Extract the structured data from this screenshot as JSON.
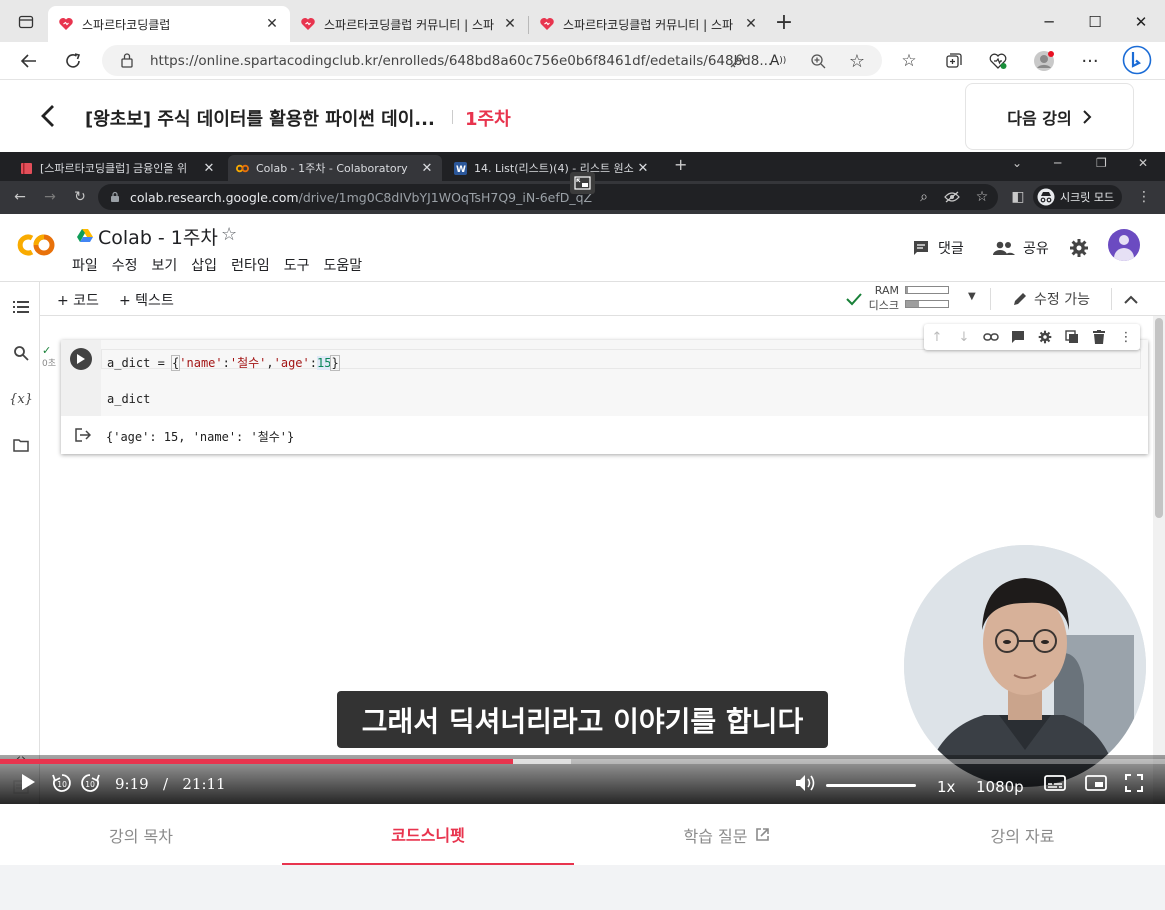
{
  "edge": {
    "tabs": [
      {
        "label": "스파르타코딩클럽"
      },
      {
        "label": "스파르타코딩클럽 커뮤니티 | 스파"
      },
      {
        "label": "스파르타코딩클럽 커뮤니티 | 스파"
      }
    ],
    "url": "https://online.spartacodingclub.kr/enrolleds/648bd8a60c756e0b6f8461df/edetails/648bd8..."
  },
  "course": {
    "title": "[왕초보] 주식 데이터를 활용한 파이썬 데이...",
    "week": "1주차",
    "next_label": "다음 강의"
  },
  "chrome": {
    "tabs": [
      {
        "label": "[스파르타코딩클럽] 금융인을 위"
      },
      {
        "label": "Colab - 1주차 - Colaboratory"
      },
      {
        "label": "14. List(리스트)(4) - 리스트 원소"
      }
    ],
    "url_domain": "colab.research.google.com",
    "url_path": "/drive/1mg0C8dIVbYJ1WOqTsH7Q9_iN-6efD_qZ",
    "incognito_label": "시크릿 모드"
  },
  "colab": {
    "title": "Colab - 1주차",
    "menu": [
      "파일",
      "수정",
      "보기",
      "삽입",
      "런타임",
      "도구",
      "도움말"
    ],
    "comment_label": "댓글",
    "share_label": "공유",
    "add_code": "+ 코드",
    "add_text": "+ 텍스트",
    "ram_label": "RAM",
    "disk_label": "디스크",
    "ram_usage": 0.05,
    "disk_usage": 0.3,
    "edit_mode": "수정 가능",
    "cell_exec_time": "0초",
    "code_line1_var": "a_dict = ",
    "code_line2": "a_dict",
    "output": "{'age': 15, 'name': '철수'}"
  },
  "video": {
    "subtitle": "그래서 딕셔너리라고 이야기를 합니다",
    "current_time": "9:19",
    "time_sep": "/",
    "duration": "21:11",
    "progress": 0.44,
    "buffered": 0.49,
    "volume": 1.0,
    "speed": "1x",
    "quality": "1080p"
  },
  "course_tabs": [
    "강의 목차",
    "코드스니펫",
    "학습 질문",
    "강의 자료"
  ],
  "colors": {
    "accent": "#e8344e",
    "colab_orange": "#f9ab00"
  }
}
